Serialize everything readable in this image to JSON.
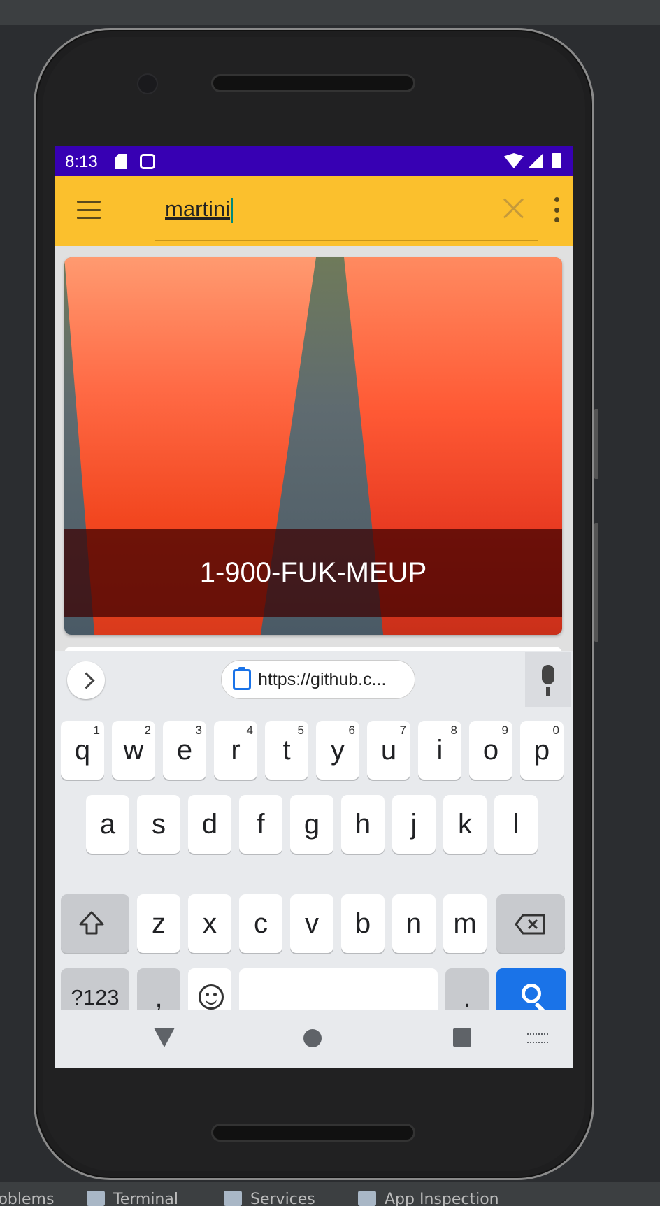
{
  "status_bar": {
    "time": "8:13",
    "background": "#3700b3"
  },
  "toolbar": {
    "search_value": "martini",
    "background": "#fbc02d"
  },
  "result_card": {
    "caption": "1-900-FUK-MEUP"
  },
  "keyboard": {
    "clipboard_suggestion": "https://github.c...",
    "rows": [
      [
        {
          "label": "q",
          "hint": "1"
        },
        {
          "label": "w",
          "hint": "2"
        },
        {
          "label": "e",
          "hint": "3"
        },
        {
          "label": "r",
          "hint": "4"
        },
        {
          "label": "t",
          "hint": "5"
        },
        {
          "label": "y",
          "hint": "6"
        },
        {
          "label": "u",
          "hint": "7"
        },
        {
          "label": "i",
          "hint": "8"
        },
        {
          "label": "o",
          "hint": "9"
        },
        {
          "label": "p",
          "hint": "0"
        }
      ],
      [
        {
          "label": "a"
        },
        {
          "label": "s"
        },
        {
          "label": "d"
        },
        {
          "label": "f"
        },
        {
          "label": "g"
        },
        {
          "label": "h"
        },
        {
          "label": "j"
        },
        {
          "label": "k"
        },
        {
          "label": "l"
        }
      ],
      [
        {
          "label": "z"
        },
        {
          "label": "x"
        },
        {
          "label": "c"
        },
        {
          "label": "v"
        },
        {
          "label": "b"
        },
        {
          "label": "n"
        },
        {
          "label": "m"
        }
      ]
    ],
    "symbols_label": "?123",
    "comma_label": ",",
    "period_label": ".",
    "action_color": "#1a73e8"
  },
  "ide_tabs": {
    "problems": "Problems",
    "terminal": "Terminal",
    "services": "Services",
    "app_inspection": "App Inspection"
  }
}
